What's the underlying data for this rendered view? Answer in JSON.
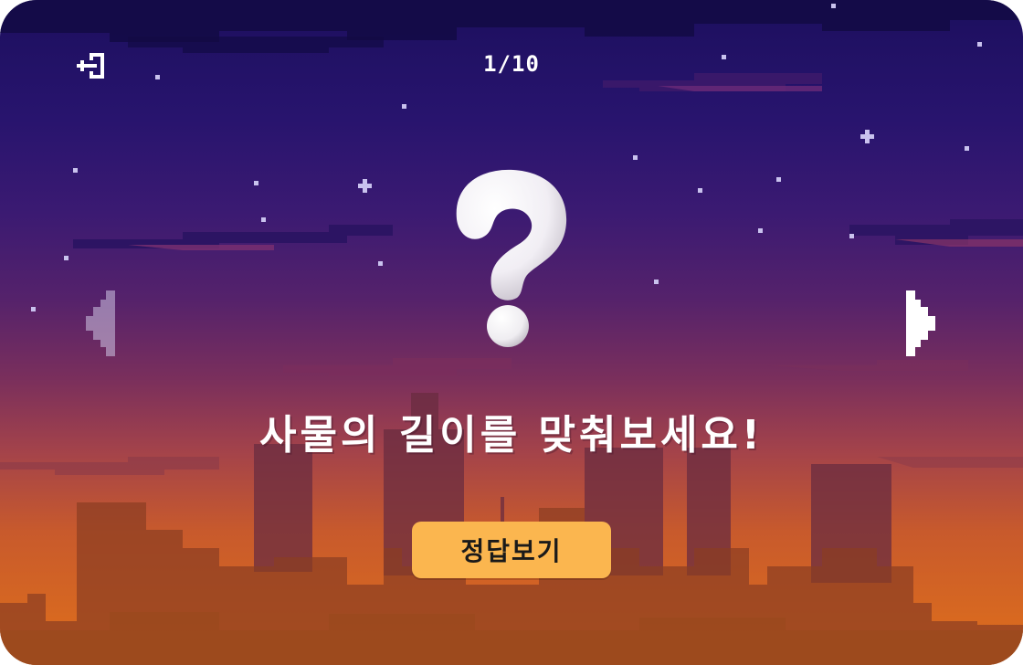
{
  "header": {
    "exit_icon": "exit-door-icon",
    "progress": "1/10",
    "current_question": 1,
    "total_questions": 10
  },
  "question": {
    "icon": "question-mark-icon",
    "prompt": "사물의 길이를 맞춰보세요!"
  },
  "navigation": {
    "prev_icon": "left-arrow-icon",
    "next_icon": "right-arrow-icon",
    "prev_enabled": false,
    "next_enabled": true
  },
  "actions": {
    "show_answer_label": "정답보기"
  },
  "colors": {
    "sky_top": "#1c0f5e",
    "sky_bottom": "#e0701a",
    "button": "#fbb64f",
    "text": "#ffffff"
  }
}
